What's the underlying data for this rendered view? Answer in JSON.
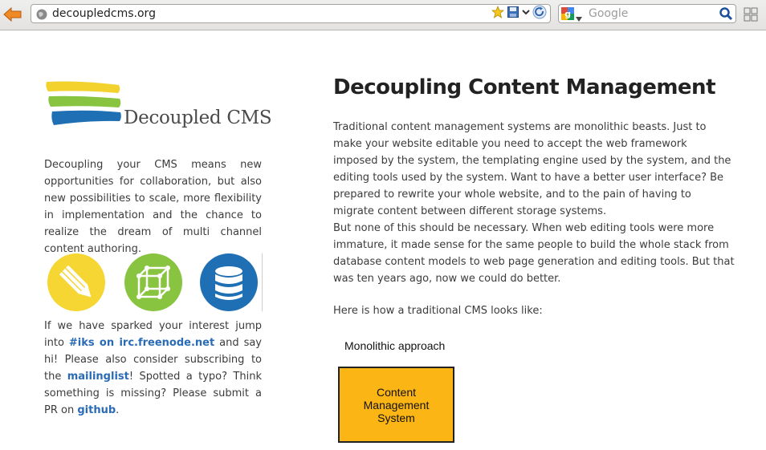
{
  "browser": {
    "url": "decoupledcms.org",
    "search_placeholder": "Google"
  },
  "sidebar": {
    "logo_text": "Decoupled CMS",
    "intro": "Decoupling your CMS means new opportunities for collaboration, but also new possibilities to scale, more flexibility in implementation and the chance to realize the dream of multi channel content authoring.",
    "outro_parts": {
      "a": "If we have sparked your interest jump into ",
      "link_irc": "#iks on irc.freenode.net",
      "b": " and say hi! Please also consider subscribing to the ",
      "link_mailinglist": "mailinglist",
      "c": "! Spotted a typo? Think something is missing? Please submit a PR on ",
      "link_github": "github",
      "d": "."
    },
    "icons": [
      "pencil-icon",
      "cube-icon",
      "database-icon"
    ]
  },
  "main": {
    "title": "Decoupling Content Management",
    "p1": "Traditional content management systems are monolithic beasts. Just to make your website editable you need to accept the web framework imposed by the system, the templating engine used by the system, and the editing tools used by the system. Want to have a better user interface? Be prepared to rewrite your whole website, and to the pain of having to migrate content between different storage systems.",
    "p2": "But none of this should be necessary. When web editing tools were more immature, it made sense for the same people to build the whole stack from database content models to web page generation and editing tools. But that was ten years ago, now we could do better.",
    "p3": "Here is how a traditional CMS looks like:",
    "diagram": {
      "label": "Monolithic approach",
      "box_text": "Content\nManagement\nSystem"
    }
  },
  "colors": {
    "link": "#2a6bb6",
    "yellow": "#f5d633",
    "green": "#88c440",
    "blue": "#1e6fb3",
    "cms_box": "#fbb515"
  }
}
